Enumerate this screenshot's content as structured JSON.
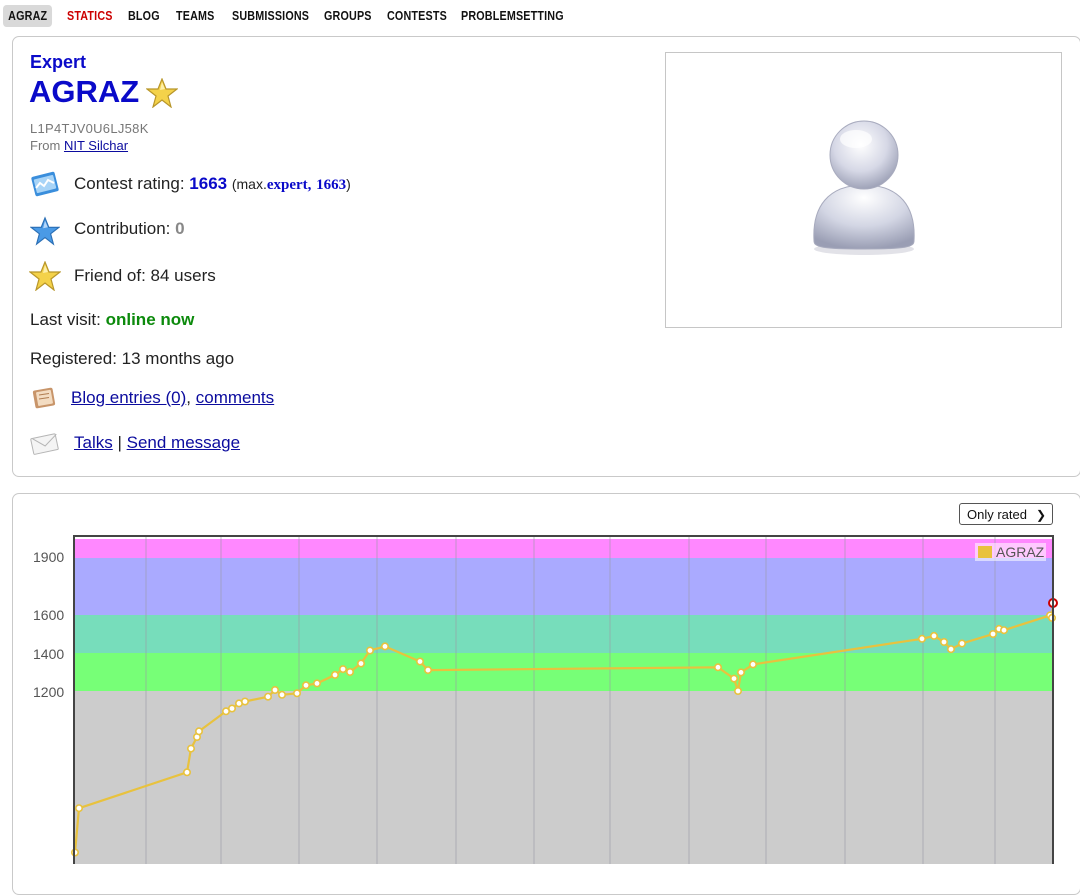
{
  "nav": {
    "items": [
      "AGRAZ",
      "STATICS",
      "BLOG",
      "TEAMS",
      "SUBMISSIONS",
      "GROUPS",
      "CONTESTS",
      "PROBLEMSETTING"
    ]
  },
  "profile": {
    "rank": "Expert",
    "handle": "AGRAZ",
    "code": "L1P4TJV0U6LJ58K",
    "from_label": "From",
    "from_link": "NIT Silchar",
    "rating_label": "Contest rating:",
    "rating_value": "1663",
    "max_open": "(max.",
    "max_rank": "expert,",
    "max_value": "1663",
    "max_close": ")",
    "contribution_label": "Contribution:",
    "contribution_value": "0",
    "friend_label": "Friend of:",
    "friend_value": "84 users",
    "last_visit_label": "Last visit:",
    "last_visit_value": "online now",
    "registered_label": "Registered:",
    "registered_value": "13 months ago",
    "blog_link": "Blog entries (0)",
    "comma": ",",
    "comments_link": "comments",
    "talks_link": "Talks",
    "sep": "|",
    "send_link": "Send message"
  },
  "colors": {
    "rank_blue": "#0a0ac9",
    "online_green": "#0c8a0c",
    "line_gold": "#e8c23e"
  },
  "icons": [
    "rating-graph-icon",
    "blue-star-icon",
    "gold-star-icon",
    "blog-book-icon",
    "envelope-icon",
    "avatar-icon"
  ],
  "graph": {
    "filter_selected": "Only rated"
  },
  "chart_data": {
    "type": "line",
    "legend": [
      "AGRAZ"
    ],
    "legend_position": "top-right",
    "yticks": [
      1200,
      1400,
      1600,
      1900
    ],
    "grid": true,
    "bands": [
      {
        "from": 0,
        "to": 1200,
        "color": "#cccccc"
      },
      {
        "from": 1200,
        "to": 1400,
        "color": "#77ff77"
      },
      {
        "from": 1400,
        "to": 1600,
        "color": "#77ddbb"
      },
      {
        "from": 1600,
        "to": 1900,
        "color": "#aaaaff"
      },
      {
        "from": 1900,
        "to": 2000,
        "color": "#ff88ff"
      }
    ],
    "series": [
      {
        "name": "AGRAZ",
        "color": "#e8c23e",
        "values": [
          350,
          583,
          772,
          897,
          958,
          988,
          1093,
          1108,
          1135,
          1145,
          1170,
          1205,
          1180,
          1188,
          1230,
          1240,
          1285,
          1315,
          1300,
          1345,
          1413,
          1435,
          1355,
          1310,
          1325,
          1265,
          1200,
          1298,
          1340,
          1475,
          1490,
          1458,
          1420,
          1450,
          1500,
          1527,
          1520,
          1598,
          1585,
          1663
        ]
      }
    ]
  }
}
